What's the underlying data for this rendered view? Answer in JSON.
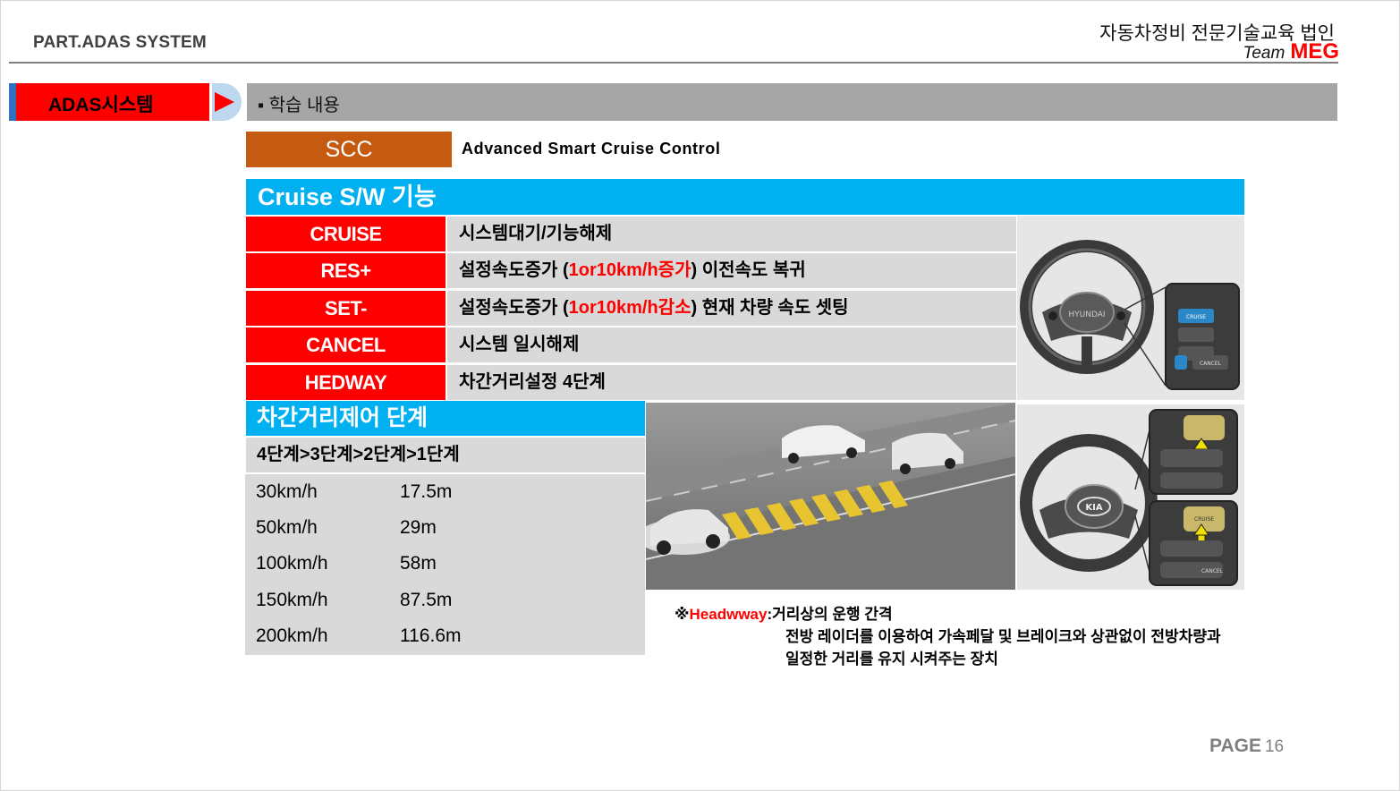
{
  "header": {
    "part": "PART.ADAS SYSTEM",
    "org": "자동차정비 전문기술교육 법인",
    "team_prefix": "Team",
    "team_name": "MEG"
  },
  "section": {
    "tab_label": "ADAS시스템",
    "learning_label": "▪ 학습 내용"
  },
  "scc": {
    "label": "SCC",
    "description": "Advanced  Smart  Cruise  Control"
  },
  "cruise": {
    "title": "Cruise  S/W  기능",
    "rows": [
      {
        "label": "CRUISE",
        "desc": "시스템대기/기능해제"
      },
      {
        "label": "RES+",
        "desc_a": "설정속도증가  (",
        "desc_red": "1or10km/h증가",
        "desc_b": ")  이전속도  복귀"
      },
      {
        "label": "SET-",
        "desc_a": "설정속도증가  (",
        "desc_red": "1or10km/h감소",
        "desc_b": ")  현재  차량  속도  셋팅"
      },
      {
        "label": "CANCEL",
        "desc": "시스템  일시해제"
      },
      {
        "label": "HEDWAY",
        "desc": "차간거리설정  4단계"
      }
    ]
  },
  "distance": {
    "title": "차간거리제어  단계",
    "steps": "4단계>3단계>2단계>1단계",
    "rows": [
      {
        "speed": "30km/h",
        "dist": "17.5m"
      },
      {
        "speed": "50km/h",
        "dist": "29m"
      },
      {
        "speed": "100km/h",
        "dist": "58m"
      },
      {
        "speed": "150km/h",
        "dist": "87.5m"
      },
      {
        "speed": "200km/h",
        "dist": "116.6m"
      }
    ]
  },
  "note": {
    "mark": "※",
    "term": "Headwway",
    "line1": ":거리상의  운행  간격",
    "line2": "전방  레이더를  이용하여  가속페달  및  브레이크와  상관없이  전방차량과",
    "line3": "일정한  거리를  유지  시켜주는  장치"
  },
  "wheel_labels": {
    "hyundai_logo": "HYUNDAI",
    "kia_logo": "KIA",
    "cruise_btn": "CRUISE",
    "cancel_btn": "CANCEL"
  },
  "footer": {
    "page_label": "PAGE",
    "page_num": "16"
  },
  "colors": {
    "red": "#ff0000",
    "cyan": "#00b0f0",
    "orange": "#c55a11",
    "gray": "#d9d9d9"
  }
}
